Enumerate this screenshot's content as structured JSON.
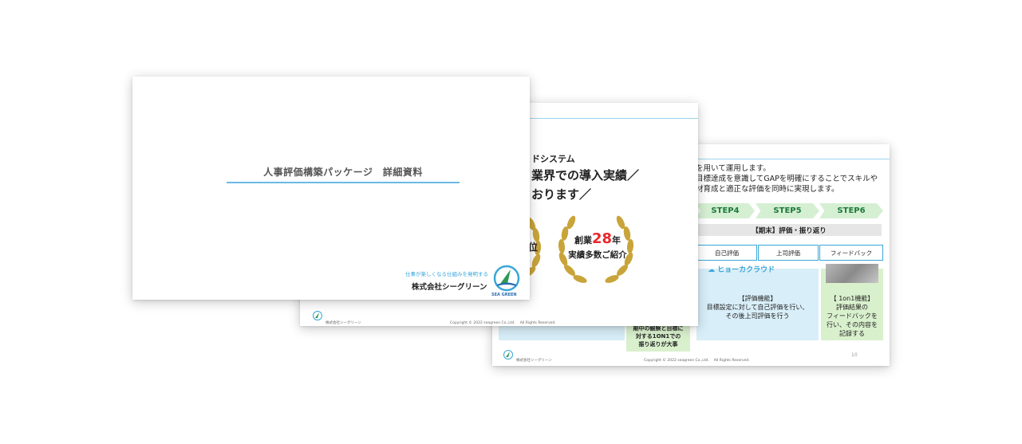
{
  "slide1": {
    "title": "人事評価構築パッケージ　詳細資料",
    "tagline": "仕事が楽しくなる仕組みを発明する",
    "company": "株式会社シーグリーン",
    "logo_text": "SEA GREEN"
  },
  "slide2": {
    "category": "ドシステム",
    "headline_1": "業界での導入実績／",
    "headline_2": "おります／",
    "partial_award": "位",
    "award_prefix": "創業",
    "award_number": "28",
    "award_suffix": "年",
    "award_line2": "実績多数ご紹介",
    "footer_company": "株式会社シーグリーン",
    "footer_copyright": "Copyright © 2022 seagreen Co.,Ltd.　 All Rights Reserved."
  },
  "slide3": {
    "intro_lines": [
      "を用いて運用します。",
      "目標達成を意識してGAPを明確にすることでスキルや",
      "材育成と適正な評価を同時に実現します。"
    ],
    "steps": [
      "STEP4",
      "STEP5",
      "STEP6"
    ],
    "phase_label": "【期末】評価・振り返り",
    "tabs": [
      "自己評価",
      "上司評価",
      "フィードバック"
    ],
    "logo_label": "ヒョーカクラウド",
    "eval_feature": [
      "【評価機能】",
      "目標設定に対して自己評価を行い、",
      "その後上司評価を行う"
    ],
    "feedback_feature": [
      "【 1on1機能】",
      "評価結果の",
      "フィードバックを",
      "行い、その内容を",
      "記録する"
    ],
    "note": [
      "期中の観察と目標に",
      "対する1ON1での",
      "振り返りが大事"
    ],
    "footer_company": "株式会社シーグリーン",
    "footer_copyright": "Copyright © 2022 seagreen Co.,Ltd.　 All Rights Reserved.",
    "page_number": "10"
  },
  "colors": {
    "accent_blue": "#6bb9e3",
    "step_green": "#d5efd3",
    "award_red": "#e8282b",
    "laurel_gold": "#c9a43a"
  }
}
